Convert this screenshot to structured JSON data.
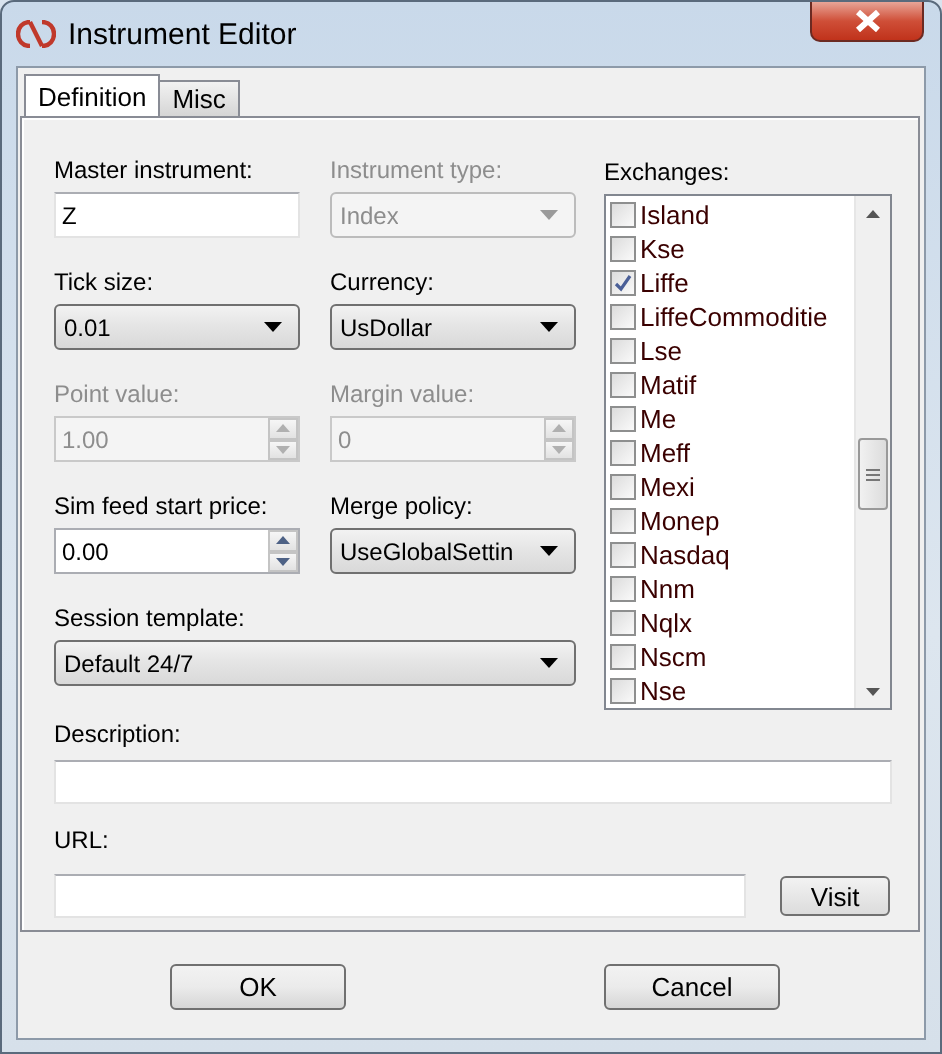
{
  "window": {
    "title": "Instrument Editor"
  },
  "tabs": [
    {
      "label": "Definition",
      "selected": true
    },
    {
      "label": "Misc",
      "selected": false
    }
  ],
  "fields": [
    {
      "kind": "text",
      "label": "Master instrument:",
      "value": "Z",
      "disabled": false
    },
    {
      "kind": "combo",
      "label": "Instrument type:",
      "value": "Index",
      "disabled": true
    },
    {
      "kind": "combo",
      "label": "Tick size:",
      "value": "0.01",
      "disabled": false
    },
    {
      "kind": "combo",
      "label": "Currency:",
      "value": "UsDollar",
      "disabled": false
    },
    {
      "kind": "spin",
      "label": "Point value:",
      "value": "1.00",
      "disabled": true
    },
    {
      "kind": "spin",
      "label": "Margin value:",
      "value": "0",
      "disabled": true
    },
    {
      "kind": "spin",
      "label": "Sim feed start price:",
      "value": "0.00",
      "disabled": false
    },
    {
      "kind": "combo",
      "label": "Merge policy:",
      "value": "UseGlobalSettin",
      "disabled": false
    }
  ],
  "session_template": {
    "label": "Session template:",
    "value": "Default 24/7"
  },
  "exchanges": {
    "label": "Exchanges:",
    "items": [
      {
        "name": "Island",
        "checked": false
      },
      {
        "name": "Kse",
        "checked": false
      },
      {
        "name": "Liffe",
        "checked": true
      },
      {
        "name": "LiffeCommoditie",
        "checked": false
      },
      {
        "name": "Lse",
        "checked": false
      },
      {
        "name": "Matif",
        "checked": false
      },
      {
        "name": "Me",
        "checked": false
      },
      {
        "name": "Meff",
        "checked": false
      },
      {
        "name": "Mexi",
        "checked": false
      },
      {
        "name": "Monep",
        "checked": false
      },
      {
        "name": "Nasdaq",
        "checked": false
      },
      {
        "name": "Nnm",
        "checked": false
      },
      {
        "name": "Nqlx",
        "checked": false
      },
      {
        "name": "Nscm",
        "checked": false
      },
      {
        "name": "Nse",
        "checked": false
      }
    ]
  },
  "description": {
    "label": "Description:"
  },
  "url": {
    "label": "URL:",
    "button": "Visit"
  },
  "buttons": [
    "OK",
    "Cancel"
  ]
}
